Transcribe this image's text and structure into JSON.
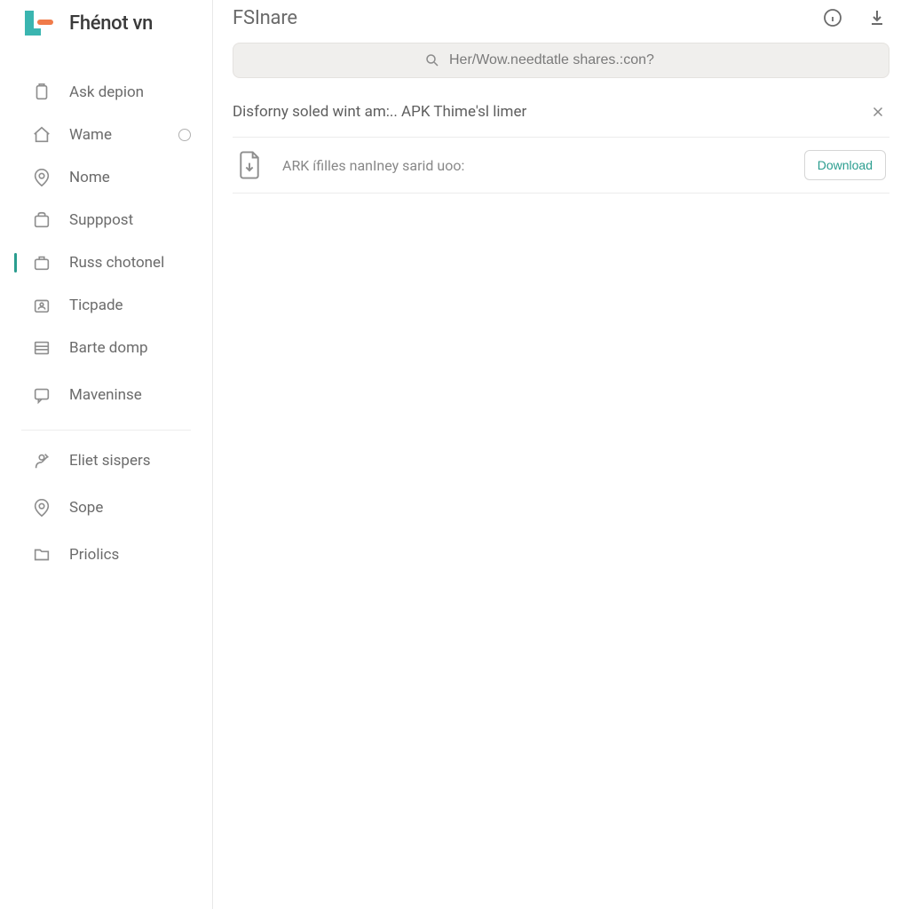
{
  "brand": {
    "name": "Fhénot vn"
  },
  "sidebar": {
    "items": [
      {
        "label": "Ask depion",
        "icon": "clipboard-icon"
      },
      {
        "label": "Wame",
        "icon": "home-icon",
        "badge": "circle"
      },
      {
        "label": "Nome",
        "icon": "pin-icon"
      },
      {
        "label": "Supppost",
        "icon": "bag-icon"
      },
      {
        "label": "Russ chotonel",
        "icon": "briefcase-icon",
        "active": true
      },
      {
        "label": "Ticpade",
        "icon": "id-card-icon"
      },
      {
        "label": "Barte domp",
        "icon": "list-icon"
      },
      {
        "label": "Maveninse",
        "icon": "comment-icon"
      }
    ],
    "secondary": [
      {
        "label": "Eliet sispers",
        "icon": "person-icon"
      },
      {
        "label": "Sope",
        "icon": "pin-icon"
      },
      {
        "label": "Priolics",
        "icon": "folder-icon"
      }
    ]
  },
  "header": {
    "title": "FSInare",
    "actions": {
      "info": "info",
      "download": "download"
    }
  },
  "search": {
    "placeholder": "Her/Wow.needtatle shares.:con?"
  },
  "notice": {
    "text": "Disforny soled wint am:.. APK Thime'sl limer"
  },
  "files": [
    {
      "name": "ARK ífilles nanIney sarid uoo:",
      "action_label": "Download"
    }
  ]
}
